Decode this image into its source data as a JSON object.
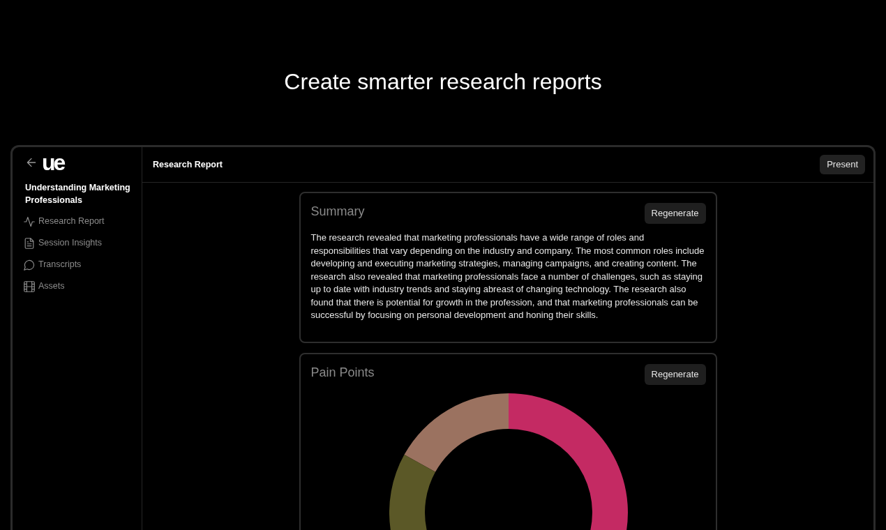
{
  "hero": {
    "headline": "Create smarter research reports"
  },
  "sidebar": {
    "logo": "ue",
    "project_title": "Understanding Marketing Professionals",
    "items": [
      {
        "label": "Research Report"
      },
      {
        "label": "Session Insights"
      },
      {
        "label": "Transcripts"
      },
      {
        "label": "Assets"
      }
    ]
  },
  "header": {
    "title": "Research Report",
    "button": "Present"
  },
  "sections": [
    {
      "kind": "text",
      "title": "Summary",
      "button": "Regenerate",
      "body": "The research revealed that marketing professionals have a wide range of roles and responsibilities that vary depending on the industry and company. The most common roles include developing and executing marketing strategies, managing campaigns, and creating content. The research also revealed that marketing professionals face a number of challenges, such as staying up to date with industry trends and staying abreast of changing technology. The research also found that there is potential for growth in the profession, and that marketing professionals can be successful by focusing on personal development and honing their skills."
    },
    {
      "kind": "donut",
      "title": "Pain Points",
      "button": "Regenerate"
    }
  ]
}
